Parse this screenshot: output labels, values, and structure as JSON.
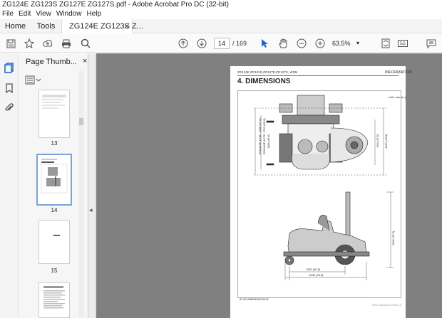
{
  "window": {
    "title": "ZG124E ZG123S ZG127E ZG127S.pdf - Adobe Acrobat Pro DC (32-bit)"
  },
  "menu": [
    "File",
    "Edit",
    "View",
    "Window",
    "Help"
  ],
  "tabs": {
    "home": "Home",
    "tools": "Tools",
    "document": "ZG124E ZG123S Z...",
    "close": "×"
  },
  "toolbar": {
    "page_current": "14",
    "page_total": "/ 169",
    "zoom": "63.5%",
    "icons": [
      "save-icon",
      "star-icon",
      "upload-icon",
      "print-icon",
      "search-icon",
      "up-arrow-icon",
      "down-arrow-icon",
      "cursor-icon",
      "hand-icon",
      "zoom-out-icon",
      "zoom-in-icon",
      "zoom-dropdown-icon",
      "fit-page-icon",
      "keyboard-icon",
      "comment-icon"
    ]
  },
  "left_rail": {
    "icons": [
      "page-thumbnails-icon",
      "bookmark-icon",
      "attachment-icon"
    ]
  },
  "thumbnails": {
    "title": "Page Thumb...",
    "close": "×",
    "pages": [
      {
        "label": "13",
        "selected": false
      },
      {
        "label": "14",
        "selected": true
      },
      {
        "label": "15",
        "selected": false
      }
    ]
  },
  "collapse_arrow": "◂",
  "document_page": {
    "header_left": "ZG124E,ZG123S,ZG127E,ZG127S, WSM",
    "header_right": "INFORMATION",
    "heading": "4.  DIMENSIONS",
    "unit": "Unit: mm (in.)",
    "dims": {
      "top_width_1": "ROKAMP-124E: 1448 (57.0)",
      "top_width_2": "ROKAMP-127E: 1752 (69.0)",
      "deck_width": "1184 (46.6)",
      "side_height_1": "954 (37.6)",
      "side_height_2": "1037 (40.8)",
      "overall_height": "1842 (72.5)",
      "wheelbase": "1155 (45.5)",
      "overall_length": "1946 (76.6)"
    },
    "figure_ref": "9Y1210680IF00010US",
    "footer_code": "KISC issued 02/2022 A"
  }
}
